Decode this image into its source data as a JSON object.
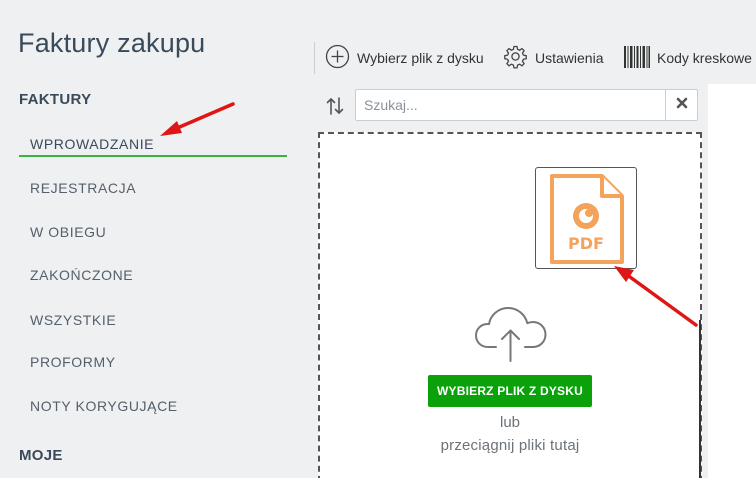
{
  "app": {
    "title": "Faktury zakupu"
  },
  "sidebar": {
    "section_faktury": "FAKTURY",
    "items": [
      {
        "label": "WPROWADZANIE",
        "active": true
      },
      {
        "label": "REJESTRACJA"
      },
      {
        "label": "W OBIEGU"
      },
      {
        "label": "ZAKOŃCZONE"
      },
      {
        "label": "WSZYSTKIE"
      },
      {
        "label": "PROFORMY"
      },
      {
        "label": "NOTY KORYGUJĄCE"
      }
    ],
    "section_moje": "MOJE",
    "accent_color": "#3cb043"
  },
  "toolbar": {
    "pick_file_label": "Wybierz plik z dysku",
    "settings_label": "Ustawienia",
    "barcodes_label": "Kody kreskowe"
  },
  "search": {
    "placeholder": "Szukaj...",
    "value": ""
  },
  "dropzone": {
    "file_badge": "PDF",
    "pick_button_label": "WYBIERZ PLIK Z DYSKU",
    "or_text": "lub",
    "drag_text": "przeciągnij pliki tutaj",
    "button_color": "#0aa10a"
  },
  "icons": {
    "add": "plus-circle-icon",
    "settings": "gear-icon",
    "barcode": "barcode-icon",
    "refresh": "refresh-icon",
    "clear": "close-icon",
    "upload": "cloud-upload-icon",
    "pdf": "pdf-file-icon"
  },
  "annotation_color": "#e01515"
}
